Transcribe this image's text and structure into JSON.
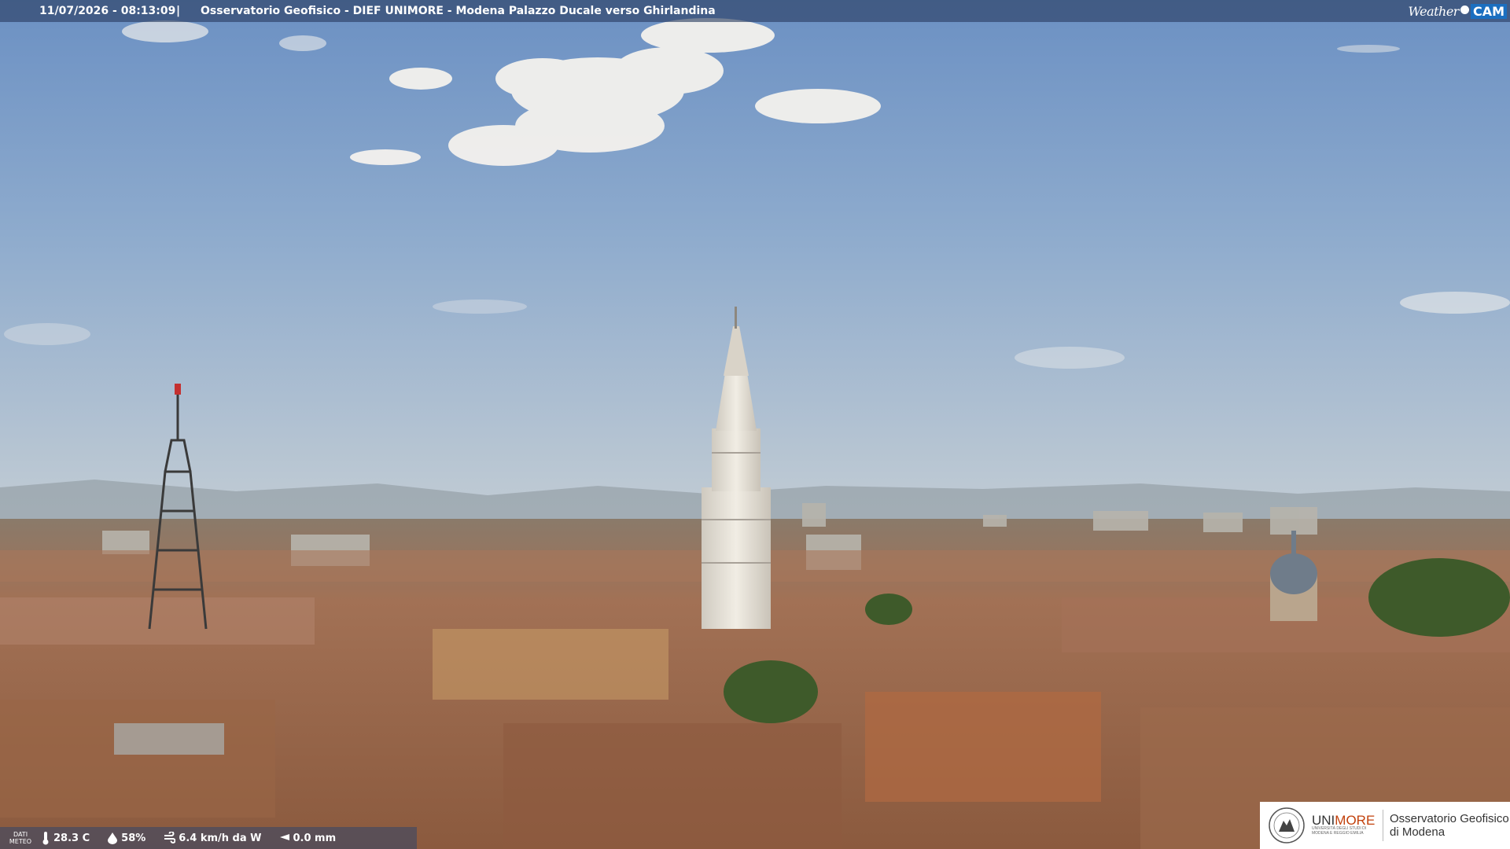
{
  "header": {
    "datetime": "11/07/2026 - 08:13:09",
    "separator": "|",
    "caption": "Osservatorio Geofisico - DIEF UNIMORE - Modena Palazzo Ducale verso Ghirlandina"
  },
  "brand": {
    "weather": "Weather",
    "cam": "CAM"
  },
  "meteo": {
    "label_line1": "DATI",
    "label_line2": "METEO",
    "temperature": "28.3 C",
    "humidity": "58%",
    "wind": "6.4 km/h da W",
    "rain": "0.0 mm",
    "icons": [
      "thermometer-icon",
      "humidity-drop-icon",
      "wind-icon",
      "rain-icon"
    ]
  },
  "logo": {
    "uni_prefix": "UNI",
    "uni_suffix": "MORE",
    "uni_subtitle": "UNIVERSITÀ DEGLI STUDI DI MODENA E REGGIO EMILIA",
    "obs_line1": "Osservatorio Geofisico",
    "obs_line2": "di Modena"
  },
  "colors": {
    "sky_top": "#6f93c4",
    "sky_bottom": "#b9c8d6",
    "roofs": "#a9704f",
    "tower": "#e6e1d8",
    "brand_accent": "#1b6fc0",
    "unimore_accent": "#c2410c"
  }
}
